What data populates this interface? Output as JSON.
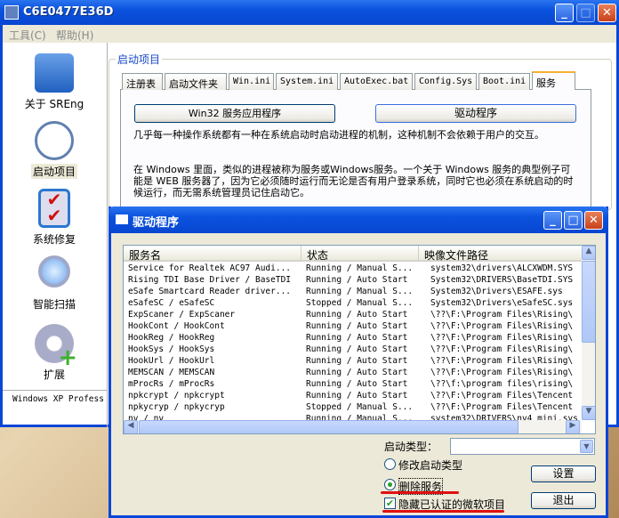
{
  "window": {
    "title": "C6E0477E36D",
    "menu": [
      "工具(C)",
      "帮助(H)"
    ]
  },
  "sidebar": {
    "items": [
      {
        "label": "关于 SREng",
        "icon": "tools-icon"
      },
      {
        "label": "启动项目",
        "icon": "clock-icon"
      },
      {
        "label": "系统修复",
        "icon": "checklist-icon"
      },
      {
        "label": "智能扫描",
        "icon": "magnifier-icon"
      },
      {
        "label": "扩展",
        "icon": "gear-plus-icon"
      }
    ],
    "footer": "Windows XP Profess"
  },
  "group": {
    "label": "启动项目",
    "tabs": [
      "注册表",
      "启动文件夹",
      "Win.ini",
      "System.ini",
      "AutoExec.bat",
      "Config.Sys",
      "Boot.ini",
      "服务"
    ],
    "active_tab": "服务",
    "buttons": [
      "Win32 服务应用程序",
      "驱动程序"
    ],
    "para1": "几乎每一种操作系统都有一种在系统启动时启动进程的机制，这种机制不会依赖于用户的交互。",
    "para2": "在 Windows 里面，类似的进程被称为服务或Windows服务。一个关于 Windows 服务的典型例子可能是 WEB 服务器了，因为它必须随时运行而无论是否有用户登录系统，同时它也必须在系统启动的时候运行，而无需系统管理员记住启动它。"
  },
  "dialog": {
    "title": "驱动程序",
    "columns": [
      "服务名",
      "状态",
      "映像文件路径"
    ],
    "rows": [
      [
        "Service for Realtek AC97 Audi...",
        "Running / Manual S...",
        "system32\\drivers\\ALCXWDM.SYS"
      ],
      [
        "Rising TDI Base Driver / BaseTDI",
        "Running / Auto Start",
        "System32\\DRIVERS\\BaseTDI.SYS"
      ],
      [
        "eSafe Smartcard Reader driver...",
        "Running / Manual S...",
        "System32\\Drivers\\ESAFE.sys"
      ],
      [
        "eSafeSC / eSafeSC",
        "Stopped / Manual S...",
        "System32\\Drivers\\eSafeSC.sys"
      ],
      [
        "ExpScaner / ExpScaner",
        "Running / Auto Start",
        "\\??\\F:\\Program Files\\Rising\\"
      ],
      [
        "HookCont / HookCont",
        "Running / Auto Start",
        "\\??\\F:\\Program Files\\Rising\\"
      ],
      [
        "HookReg / HookReg",
        "Running / Auto Start",
        "\\??\\F:\\Program Files\\Rising\\"
      ],
      [
        "HookSys / HookSys",
        "Running / Auto Start",
        "\\??\\F:\\Program Files\\Rising\\"
      ],
      [
        "HookUrl / HookUrl",
        "Running / Auto Start",
        "\\??\\F:\\Program Files\\Rising\\"
      ],
      [
        "MEMSCAN / MEMSCAN",
        "Running / Auto Start",
        "\\??\\F:\\Program Files\\Rising\\"
      ],
      [
        "mProcRs / mProcRs",
        "Running / Auto Start",
        "\\??\\f:\\program files\\rising\\"
      ],
      [
        "npkcrypt / npkcrypt",
        "Running / Auto Start",
        "\\??\\F:\\Program Files\\Tencent"
      ],
      [
        "npkycryp / npkycryp",
        "Stopped / Manual S...",
        "\\??\\F:\\Program Files\\Tencent"
      ],
      [
        "nv / nv",
        "Running / Manual S...",
        "system32\\DRIVERS\\nv4_mini.sys"
      ]
    ],
    "start_type_label": "启动类型：",
    "start_type_value": "",
    "radio_modify": "修改启动类型",
    "radio_delete": "删除服务",
    "radio_selected": "删除服务",
    "checkbox_hide": "隐藏已认证的微软项目",
    "checkbox_checked": true,
    "btn_set": "设置",
    "btn_exit": "退出"
  }
}
